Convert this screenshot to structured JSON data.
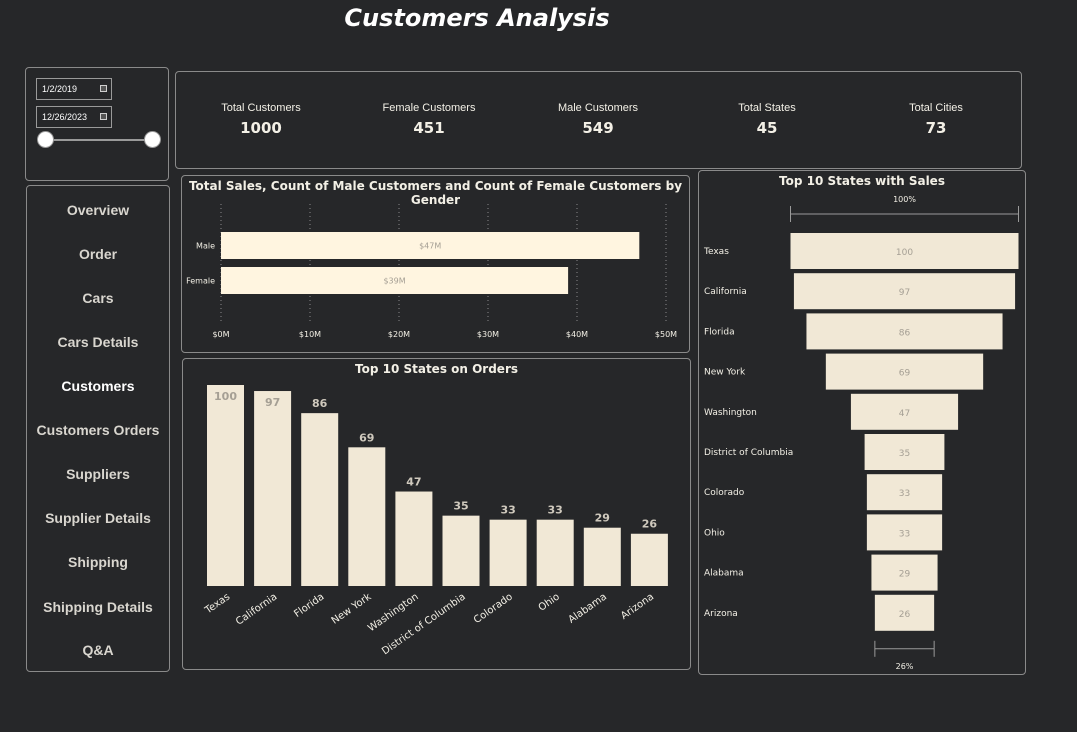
{
  "title": "Customers Analysis",
  "date_slicer": {
    "start": "1/2/2019",
    "end": "12/26/2023"
  },
  "nav": {
    "items": [
      {
        "label": "Overview",
        "active": false
      },
      {
        "label": "Order",
        "active": false
      },
      {
        "label": "Cars",
        "active": false
      },
      {
        "label": "Cars Details",
        "active": false
      },
      {
        "label": "Customers",
        "active": true
      },
      {
        "label": "Customers Orders",
        "active": false
      },
      {
        "label": "Suppliers",
        "active": false
      },
      {
        "label": "Supplier Details",
        "active": false
      },
      {
        "label": "Shipping",
        "active": false
      },
      {
        "label": "Shipping Details",
        "active": false
      },
      {
        "label": "Q&A",
        "active": false
      }
    ]
  },
  "kpis": [
    {
      "label": "Total Customers",
      "value": "1000"
    },
    {
      "label": "Female Customers",
      "value": "451"
    },
    {
      "label": "Male Customers",
      "value": "549"
    },
    {
      "label": "Total States",
      "value": "45"
    },
    {
      "label": "Total Cities",
      "value": "73"
    }
  ],
  "colors": {
    "background": "#262729",
    "bar_fill": "#f1e8d6",
    "bar_fill_light": "#fff5e0",
    "text": "#f3f0e6",
    "muted": "#a59f94"
  },
  "chart_data": [
    {
      "type": "bar",
      "orientation": "horizontal",
      "title": "Total Sales, Count of Male Customers and Count of Female Customers by Gender",
      "categories": [
        "Male",
        "Female"
      ],
      "values": [
        47,
        39
      ],
      "data_labels": [
        "$47M",
        "$39M"
      ],
      "xlim": [
        0,
        50
      ],
      "tick_values": [
        0,
        10,
        20,
        30,
        40,
        50
      ],
      "tick_labels": [
        "$0M",
        "$10M",
        "$20M",
        "$30M",
        "$40M",
        "$50M"
      ],
      "grid": true
    },
    {
      "type": "bar",
      "title": "Top 10 States on Orders",
      "categories": [
        "Texas",
        "California",
        "Florida",
        "New York",
        "Washington",
        "District of Columbia",
        "Colorado",
        "Ohio",
        "Alabama",
        "Arizona"
      ],
      "values": [
        100,
        97,
        86,
        69,
        47,
        35,
        33,
        33,
        29,
        26
      ],
      "ylim": [
        0,
        100
      ]
    },
    {
      "type": "funnel",
      "title": "Top 10 States with Sales",
      "categories": [
        "Texas",
        "California",
        "Florida",
        "New York",
        "Washington",
        "District of Columbia",
        "Colorado",
        "Ohio",
        "Alabama",
        "Arizona"
      ],
      "values": [
        100,
        97,
        86,
        69,
        47,
        35,
        33,
        33,
        29,
        26
      ],
      "top_percent_label": "100%",
      "bottom_percent_label": "26%"
    }
  ]
}
